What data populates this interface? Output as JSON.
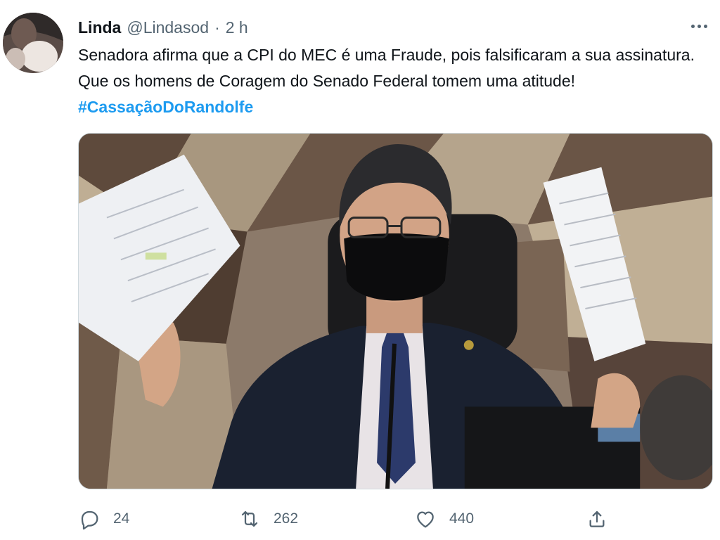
{
  "tweet": {
    "author_name": "Linda",
    "handle": "@Lindasod",
    "separator": "·",
    "time": "2 h",
    "text_main": "Senadora afirma que a CPI do MEC é uma Fraude, pois falsificaram a sua assinatura. Que os homens de Coragem do Senado Federal tomem uma atitude! ",
    "hashtag": "#CassaçãoDoRandolfe"
  },
  "actions": {
    "reply_count": "24",
    "retweet_count": "262",
    "like_count": "440"
  },
  "icons": {
    "reply": "speech-bubble-icon",
    "retweet": "retweet-arrows-icon",
    "like": "heart-icon",
    "share": "share-upload-icon",
    "more": "more-dots-icon"
  },
  "colors": {
    "accent": "#1d9bf0",
    "secondary_text": "#536471",
    "primary_text": "#0f1419"
  }
}
